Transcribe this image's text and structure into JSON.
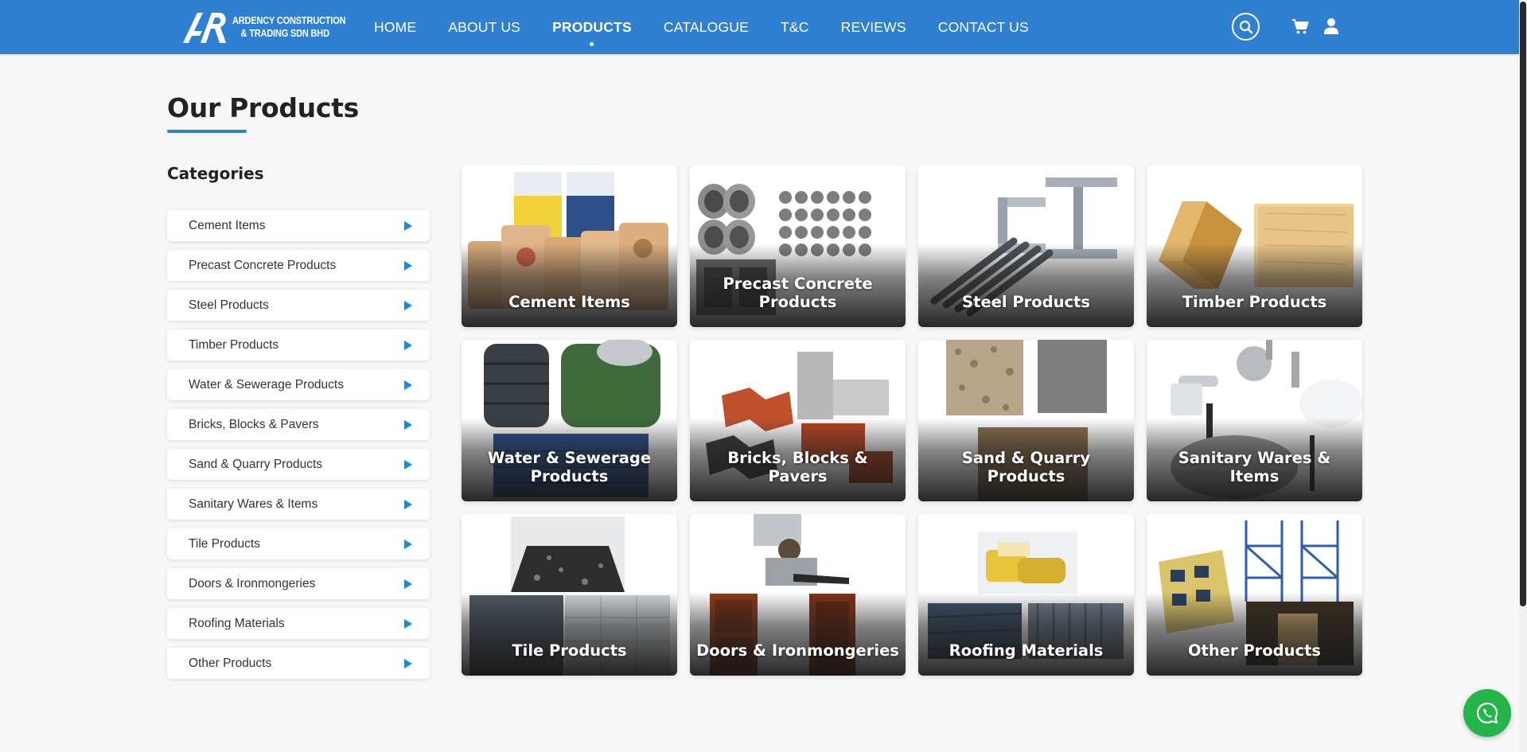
{
  "brand": {
    "line1": "ARDENCY CONSTRUCTION",
    "line2": "& TRADING SDN BHD",
    "color": "#2f80d2"
  },
  "nav": {
    "items": [
      {
        "label": "HOME"
      },
      {
        "label": "ABOUT US"
      },
      {
        "label": "PRODUCTS",
        "active": true
      },
      {
        "label": "CATALOGUE"
      },
      {
        "label": "T&C"
      },
      {
        "label": "REVIEWS"
      },
      {
        "label": "CONTACT US"
      }
    ],
    "icons": [
      "search-icon",
      "cart-icon",
      "user-icon"
    ]
  },
  "page": {
    "title": "Our Products"
  },
  "sidebar": {
    "heading": "Categories",
    "items": [
      {
        "label": "Cement Items"
      },
      {
        "label": "Precast Concrete Products"
      },
      {
        "label": "Steel Products"
      },
      {
        "label": "Timber Products"
      },
      {
        "label": "Water & Sewerage Products"
      },
      {
        "label": "Bricks, Blocks & Pavers"
      },
      {
        "label": "Sand & Quarry Products"
      },
      {
        "label": "Sanitary Wares & Items"
      },
      {
        "label": "Tile Products"
      },
      {
        "label": "Doors & Ironmongeries"
      },
      {
        "label": "Roofing Materials"
      },
      {
        "label": "Other Products"
      }
    ],
    "arrow_icon": "play-arrow-icon",
    "arrow_color": "#1c8ad8"
  },
  "products": [
    {
      "label": "Cement Items"
    },
    {
      "label": "Precast Concrete Products"
    },
    {
      "label": "Steel Products"
    },
    {
      "label": "Timber Products"
    },
    {
      "label": "Water & Sewerage Products"
    },
    {
      "label": "Bricks, Blocks & Pavers"
    },
    {
      "label": "Sand & Quarry Products"
    },
    {
      "label": "Sanitary Wares & Items"
    },
    {
      "label": "Tile Products"
    },
    {
      "label": "Doors & Ironmongeries"
    },
    {
      "label": "Roofing Materials"
    },
    {
      "label": "Other Products"
    }
  ],
  "floating": {
    "icon": "whatsapp-icon",
    "color": "#25b449"
  }
}
